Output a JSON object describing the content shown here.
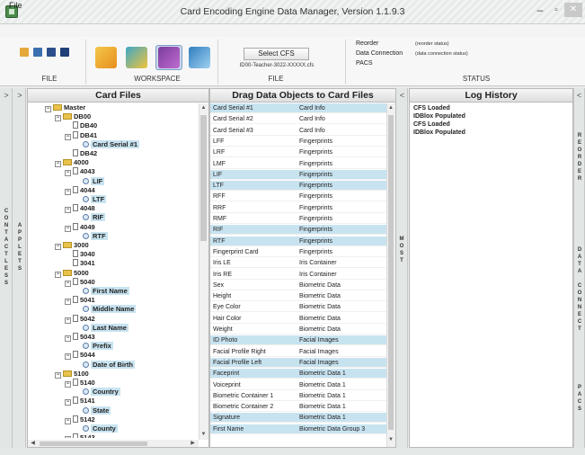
{
  "window": {
    "title": "Card Encoding Engine Data Manager, Version 1.1.9.3",
    "minimize": "–",
    "maximize": "▫",
    "close": "✕"
  },
  "menu": {
    "file": "File"
  },
  "ribbon": {
    "file_group": "FILE",
    "workspace_group": "WORKSPACE",
    "file2_group": "FILE",
    "status_group": "STATUS",
    "select_cfs": "Select CFS",
    "cfs_file_name": "ID00-Teacher-3022-XXXXX.cfs",
    "status_labels": [
      "Reorder",
      "Data Connection",
      "PACS"
    ],
    "status_values": [
      "(reorder status)",
      "(data connection status)",
      ""
    ]
  },
  "side": {
    "collapse_left_1": ">",
    "collapse_left_2": ">",
    "contactless": "C\nO\nN\nT\nA\nC\nT\nL\nE\nS\nS",
    "applets": "A\nP\nP\nL\nE\nT\nS",
    "collapse_mid": "<",
    "most": "M\nO\nS\nT",
    "collapse_right": "<",
    "reorder": "R\nE\nO\nR\nD\nE\nR",
    "data_connect": "D\nA\nT\nA\n\nC\nO\nN\nN\nE\nC\nT",
    "pacs": "P\nA\nC\nS"
  },
  "panels": {
    "card_files": "Card Files",
    "drag": "Drag Data Objects to Card Files",
    "log": "Log History"
  },
  "tree": [
    {
      "level": 0,
      "kind": "folder",
      "exp": "−",
      "label": "Master"
    },
    {
      "level": 1,
      "kind": "folder",
      "exp": "−",
      "label": "DB00"
    },
    {
      "level": 2,
      "kind": "doc",
      "exp": "",
      "label": "DB40"
    },
    {
      "level": 2,
      "kind": "doc",
      "exp": "−",
      "label": "DB41"
    },
    {
      "level": 3,
      "kind": "field",
      "exp": "",
      "label": "Card Serial #1",
      "hl": true
    },
    {
      "level": 2,
      "kind": "doc",
      "exp": "",
      "label": "DB42"
    },
    {
      "level": 1,
      "kind": "folder",
      "exp": "−",
      "label": "4000"
    },
    {
      "level": 2,
      "kind": "doc",
      "exp": "−",
      "label": "4043"
    },
    {
      "level": 3,
      "kind": "field",
      "exp": "",
      "label": "LIF",
      "hl": true
    },
    {
      "level": 2,
      "kind": "doc",
      "exp": "−",
      "label": "4044"
    },
    {
      "level": 3,
      "kind": "field",
      "exp": "",
      "label": "LTF",
      "hl": true
    },
    {
      "level": 2,
      "kind": "doc",
      "exp": "−",
      "label": "4048"
    },
    {
      "level": 3,
      "kind": "field",
      "exp": "",
      "label": "RIF",
      "hl": true
    },
    {
      "level": 2,
      "kind": "doc",
      "exp": "−",
      "label": "4049"
    },
    {
      "level": 3,
      "kind": "field",
      "exp": "",
      "label": "RTF",
      "hl": true
    },
    {
      "level": 1,
      "kind": "folder",
      "exp": "−",
      "label": "3000"
    },
    {
      "level": 2,
      "kind": "doc",
      "exp": "",
      "label": "3040"
    },
    {
      "level": 2,
      "kind": "doc",
      "exp": "",
      "label": "3041"
    },
    {
      "level": 1,
      "kind": "folder",
      "exp": "−",
      "label": "5000"
    },
    {
      "level": 2,
      "kind": "doc",
      "exp": "−",
      "label": "5040"
    },
    {
      "level": 3,
      "kind": "field",
      "exp": "",
      "label": "First Name",
      "hl": true
    },
    {
      "level": 2,
      "kind": "doc",
      "exp": "−",
      "label": "5041"
    },
    {
      "level": 3,
      "kind": "field",
      "exp": "",
      "label": "Middle Name",
      "hl": true
    },
    {
      "level": 2,
      "kind": "doc",
      "exp": "−",
      "label": "5042"
    },
    {
      "level": 3,
      "kind": "field",
      "exp": "",
      "label": "Last Name",
      "hl": true
    },
    {
      "level": 2,
      "kind": "doc",
      "exp": "−",
      "label": "5043"
    },
    {
      "level": 3,
      "kind": "field",
      "exp": "",
      "label": "Prefix",
      "hl": true
    },
    {
      "level": 2,
      "kind": "doc",
      "exp": "−",
      "label": "5044"
    },
    {
      "level": 3,
      "kind": "field",
      "exp": "",
      "label": "Date of Birth",
      "hl": true
    },
    {
      "level": 1,
      "kind": "folder",
      "exp": "−",
      "label": "5100"
    },
    {
      "level": 2,
      "kind": "doc",
      "exp": "−",
      "label": "5140"
    },
    {
      "level": 3,
      "kind": "field",
      "exp": "",
      "label": "Country",
      "hl": true
    },
    {
      "level": 2,
      "kind": "doc",
      "exp": "−",
      "label": "5141"
    },
    {
      "level": 3,
      "kind": "field",
      "exp": "",
      "label": "State",
      "hl": true
    },
    {
      "level": 2,
      "kind": "doc",
      "exp": "−",
      "label": "5142"
    },
    {
      "level": 3,
      "kind": "field",
      "exp": "",
      "label": "County",
      "hl": true
    },
    {
      "level": 2,
      "kind": "doc",
      "exp": "−",
      "label": "5143"
    }
  ],
  "grid": [
    {
      "name": "Card Serial #1",
      "type": "Card Info",
      "sel": true
    },
    {
      "name": "Card Serial #2",
      "type": "Card Info",
      "sel": false
    },
    {
      "name": "Card Serial #3",
      "type": "Card Info",
      "sel": false
    },
    {
      "name": "LFF",
      "type": "Fingerprints",
      "sel": false
    },
    {
      "name": "LRF",
      "type": "Fingerprints",
      "sel": false
    },
    {
      "name": "LMF",
      "type": "Fingerprints",
      "sel": false
    },
    {
      "name": "LIF",
      "type": "Fingerprints",
      "sel": true
    },
    {
      "name": "LTF",
      "type": "Fingerprints",
      "sel": true
    },
    {
      "name": "RFF",
      "type": "Fingerprints",
      "sel": false
    },
    {
      "name": "RRF",
      "type": "Fingerprints",
      "sel": false
    },
    {
      "name": "RMF",
      "type": "Fingerprints",
      "sel": false
    },
    {
      "name": "RIF",
      "type": "Fingerprints",
      "sel": true
    },
    {
      "name": "RTF",
      "type": "Fingerprints",
      "sel": true
    },
    {
      "name": "Fingerprint Card",
      "type": "Fingerprints",
      "sel": false
    },
    {
      "name": "Iris LE",
      "type": "Iris Container",
      "sel": false
    },
    {
      "name": "Iris RE",
      "type": "Iris Container",
      "sel": false
    },
    {
      "name": "Sex",
      "type": "Biometric Data",
      "sel": false
    },
    {
      "name": "Height",
      "type": "Biometric Data",
      "sel": false
    },
    {
      "name": "Eye Color",
      "type": "Biometric Data",
      "sel": false
    },
    {
      "name": "Hair Color",
      "type": "Biometric Data",
      "sel": false
    },
    {
      "name": "Weight",
      "type": "Biometric Data",
      "sel": false
    },
    {
      "name": "ID Photo",
      "type": "Facial Images",
      "sel": true
    },
    {
      "name": "Facial Profile Right",
      "type": "Facial Images",
      "sel": false
    },
    {
      "name": "Facial Profile Left",
      "type": "Facial Images",
      "sel": true
    },
    {
      "name": "Faceprint",
      "type": "Biometric Data 1",
      "sel": true
    },
    {
      "name": "Voiceprint",
      "type": "Biometric Data 1",
      "sel": false
    },
    {
      "name": "Biometric Container 1",
      "type": "Biometric Data 1",
      "sel": false
    },
    {
      "name": "Biometric Container 2",
      "type": "Biometric Data 1",
      "sel": false
    },
    {
      "name": "Signature",
      "type": "Biometric Data 1",
      "sel": true
    },
    {
      "name": "First Name",
      "type": "Biometric Data Group 3",
      "sel": true
    }
  ],
  "log": [
    "CFS Loaded",
    "IDBlox Populated",
    "CFS Loaded",
    "IDBlox Populated"
  ],
  "scroll": {
    "up": "▲",
    "down": "▼",
    "left": "◀",
    "right": "▶"
  }
}
